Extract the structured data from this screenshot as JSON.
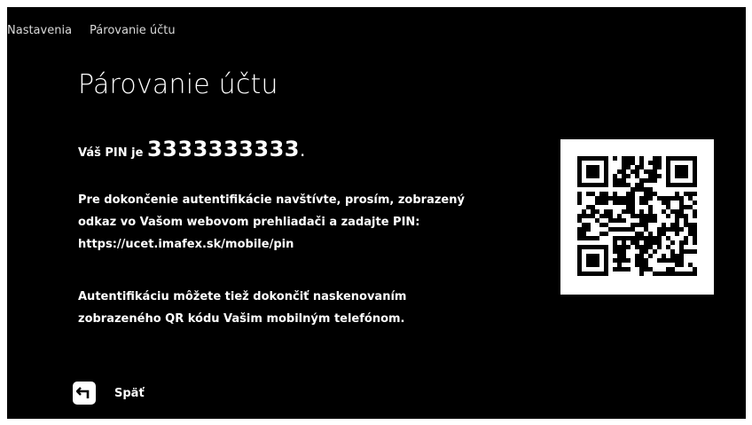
{
  "breadcrumb": {
    "items": [
      "Nastavenia",
      "Párovanie účtu"
    ]
  },
  "page": {
    "title": "Párovanie účtu"
  },
  "pin": {
    "prefix": "Váš PIN je ",
    "value": "3333333333",
    "suffix": "."
  },
  "instructions": {
    "lines": [
      "Pre dokončenie autentifikácie navštívte, prosím, zobrazený",
      "odkaz vo Vašom webovom prehliadači a zadajte PIN:",
      "https://ucet.imafex.sk/mobile/pin"
    ]
  },
  "qr_instructions": {
    "lines": [
      "Autentifikáciu môžete tiež dokončiť naskenovaním",
      "zobrazeného QR kódu Vašim mobilným telefónom."
    ]
  },
  "back": {
    "label": "Späť",
    "icon": "back-arrow-icon"
  },
  "qr": {
    "icon": "qr-code"
  }
}
